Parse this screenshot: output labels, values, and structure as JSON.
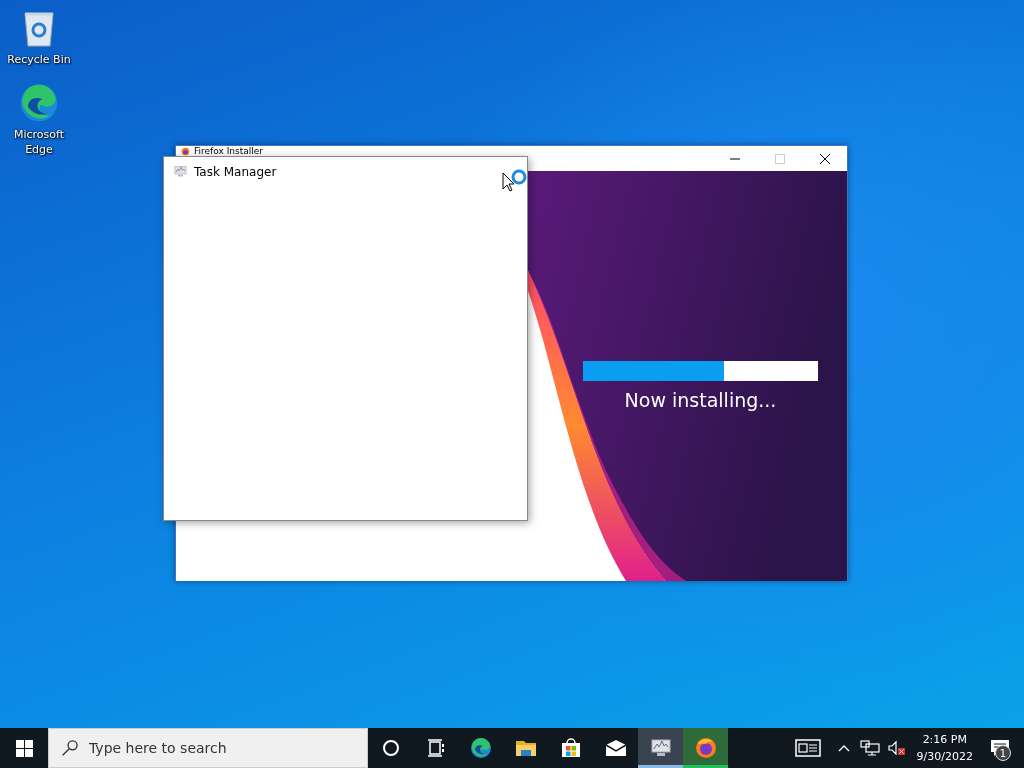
{
  "desktop_icons": [
    {
      "kind": "recycle-bin",
      "label": "Recycle Bin"
    },
    {
      "kind": "edge",
      "label": "Microsoft Edge"
    }
  ],
  "windows": [
    {
      "kind": "installer",
      "title": "Firefox Installer",
      "progress": {
        "level": 0.6
      },
      "status": "Now installing..."
    },
    {
      "kind": "blank",
      "title": "Task Manager",
      "busy": true
    }
  ],
  "taskbar": {
    "search": {
      "placeholder": "Type here to search"
    },
    "apps": [
      {
        "kind": "cortana",
        "selected": false,
        "running": false,
        "flashing": false
      },
      {
        "kind": "task-view",
        "selected": false,
        "running": false,
        "flashing": false
      },
      {
        "kind": "edge",
        "selected": false,
        "running": false,
        "flashing": false
      },
      {
        "kind": "explorer",
        "selected": false,
        "running": false,
        "flashing": false
      },
      {
        "kind": "store",
        "selected": false,
        "running": false,
        "flashing": false
      },
      {
        "kind": "mail",
        "selected": false,
        "running": false,
        "flashing": false
      },
      {
        "kind": "task-manager",
        "selected": true,
        "running": true,
        "flashing": false
      },
      {
        "kind": "firefox",
        "selected": false,
        "running": true,
        "flashing": true
      }
    ],
    "time": "2:16 PM",
    "date": "9/30/2022",
    "notifications": "1"
  }
}
